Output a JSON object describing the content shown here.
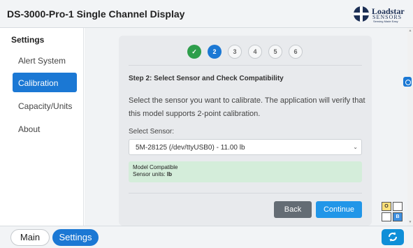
{
  "app": {
    "title": "DS-3000-Pro-1 Single Channel Display"
  },
  "logo": {
    "brand": "Loadstar",
    "brand_line2": "SENSORS",
    "tagline": "Sensing Made Easy"
  },
  "sidebar": {
    "heading": "Settings",
    "items": [
      {
        "label": "Alert System",
        "active": false
      },
      {
        "label": "Calibration",
        "active": true
      },
      {
        "label": "Capacity/Units",
        "active": false
      },
      {
        "label": "About",
        "active": false
      }
    ]
  },
  "wizard": {
    "steps": [
      {
        "label": "✓",
        "state": "done"
      },
      {
        "label": "2",
        "state": "current"
      },
      {
        "label": "3",
        "state": "todo"
      },
      {
        "label": "4",
        "state": "todo"
      },
      {
        "label": "5",
        "state": "todo"
      },
      {
        "label": "6",
        "state": "todo"
      }
    ],
    "step_title": "Step 2: Select Sensor and Check Compatibility",
    "description": "Select the sensor you want to calibrate. The application will verify that this model supports 2-point calibration.",
    "select_label": "Select Sensor:",
    "select_value": "5M-28125 (/dev/ttyUSB0) - 11.00 lb",
    "alert": {
      "line1": "Model Compatible",
      "units_label": "Sensor units: ",
      "units_value": "lb"
    },
    "back_label": "Back",
    "continue_label": "Continue"
  },
  "grid_widget": {
    "cells": [
      "O",
      "",
      "",
      "B"
    ]
  },
  "footer": {
    "tab_main": "Main",
    "tab_settings": "Settings"
  },
  "colors": {
    "accent": "#1b78d4",
    "success": "#2e9e4b",
    "alert_bg": "#d4edda",
    "continue": "#2196e8",
    "back": "#646c74"
  }
}
